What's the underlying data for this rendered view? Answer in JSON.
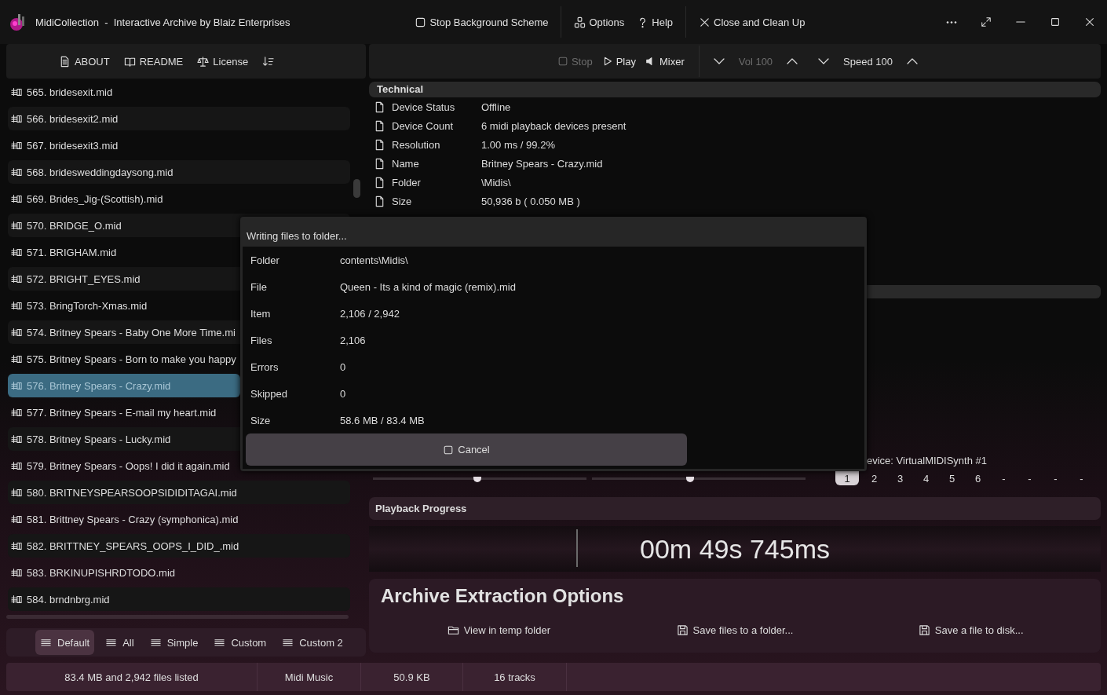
{
  "window": {
    "title": "MidiCollection  -  Interactive Archive by Blaiz Enterprises"
  },
  "title_actions": [
    {
      "label": "Stop Background Scheme"
    },
    {
      "label": "Options"
    },
    {
      "label": "Help"
    },
    {
      "label": "Close and Clean Up"
    }
  ],
  "left_toolbar": [
    {
      "label": "ABOUT"
    },
    {
      "label": "README"
    },
    {
      "label": "License"
    }
  ],
  "file_list": [
    {
      "label": "565. bridesexit.mid",
      "selected": false
    },
    {
      "label": "566. bridesexit2.mid",
      "selected": false
    },
    {
      "label": "567. bridesexit3.mid",
      "selected": false
    },
    {
      "label": "568. bridesweddingdaysong.mid",
      "selected": false
    },
    {
      "label": "569. Brides_Jig-(Scottish).mid",
      "selected": false
    },
    {
      "label": "570. BRIDGE_O.mid",
      "selected": false
    },
    {
      "label": "571. BRIGHAM.mid",
      "selected": false
    },
    {
      "label": "572. BRIGHT_EYES.mid",
      "selected": false
    },
    {
      "label": "573. BringTorch-Xmas.mid",
      "selected": false
    },
    {
      "label": "574. Britney Spears - Baby One More Time.mi",
      "selected": false
    },
    {
      "label": "575. Britney Spears - Born to make you happy",
      "selected": false
    },
    {
      "label": "576. Britney Spears - Crazy.mid",
      "selected": true
    },
    {
      "label": "577. Britney Spears - E-mail my heart.mid",
      "selected": false
    },
    {
      "label": "578. Britney Spears - Lucky.mid",
      "selected": false
    },
    {
      "label": "579. Britney Spears - Oops! I did it again.mid",
      "selected": false
    },
    {
      "label": "580. BRITNEYSPEARSOOPSIDIDITAGAI.mid",
      "selected": false
    },
    {
      "label": "581. Brittney Spears - Crazy (symphonica).mid",
      "selected": false
    },
    {
      "label": "582. BRITTNEY_SPEARS_OOPS_I_DID_.mid",
      "selected": false
    },
    {
      "label": "583. BRKINUPISHRDTODO.mid",
      "selected": false
    },
    {
      "label": "584. brndnbrg.mid",
      "selected": false
    }
  ],
  "view_tabs": [
    {
      "label": "Default",
      "selected": true
    },
    {
      "label": "All",
      "selected": false
    },
    {
      "label": "Simple",
      "selected": false
    },
    {
      "label": "Custom",
      "selected": false
    },
    {
      "label": "Custom 2",
      "selected": false
    }
  ],
  "transport": [
    {
      "label": "Stop",
      "disabled": true
    },
    {
      "label": "Play",
      "disabled": false
    },
    {
      "label": "Mixer",
      "disabled": false
    }
  ],
  "volume": {
    "label": "Vol 100",
    "disabled": true
  },
  "speed": {
    "label": "Speed 100",
    "disabled": false
  },
  "technical": {
    "title": "Technical",
    "rows": [
      {
        "label": "Device Status",
        "value": "Offline"
      },
      {
        "label": "Device Count",
        "value": "6 midi playback devices present"
      },
      {
        "label": "Resolution",
        "value": "1.00 ms / 99.2%"
      },
      {
        "label": "Name",
        "value": "Britney Spears - Crazy.mid"
      },
      {
        "label": "Folder",
        "value": "\\Midis\\"
      },
      {
        "label": "Size",
        "value": "50,936 b  ( 0.050 MB )"
      }
    ]
  },
  "device": {
    "label": "evice: VirtualMIDISynth #1",
    "sliders": [
      {
        "level": 0.49
      },
      {
        "level": 0.46
      }
    ],
    "channels": [
      {
        "label": "1",
        "selected": true
      },
      {
        "label": "2",
        "selected": false
      },
      {
        "label": "3",
        "selected": false
      },
      {
        "label": "4",
        "selected": false
      },
      {
        "label": "5",
        "selected": false
      },
      {
        "label": "6",
        "selected": false
      },
      {
        "label": "-",
        "selected": false
      },
      {
        "label": "-",
        "selected": false
      },
      {
        "label": "-",
        "selected": false
      },
      {
        "label": "-",
        "selected": false
      }
    ]
  },
  "playback": {
    "title": "Playback Progress",
    "time": "00m 49s 745ms"
  },
  "archive": {
    "title": "Archive Extraction Options",
    "actions": [
      {
        "label": "View in temp folder"
      },
      {
        "label": "Save files to a folder..."
      },
      {
        "label": "Save a file to disk..."
      }
    ]
  },
  "status_bar": [
    "83.4 MB and 2,942 files listed",
    "Midi Music",
    "50.9 KB",
    "16 tracks"
  ],
  "dialog": {
    "title": "Writing files to folder...",
    "rows": [
      {
        "label": "Folder",
        "value": "contents\\Midis\\"
      },
      {
        "label": "File",
        "value": "Queen - Its a kind of magic (remix).mid"
      },
      {
        "label": "Item",
        "value": "2,106 / 2,942"
      },
      {
        "label": "Files",
        "value": "2,106"
      },
      {
        "label": "Errors",
        "value": "0"
      },
      {
        "label": "Skipped",
        "value": "0"
      },
      {
        "label": "Size",
        "value": "58.6 MB / 83.4 MB"
      }
    ],
    "button": {
      "label": "Cancel"
    }
  }
}
